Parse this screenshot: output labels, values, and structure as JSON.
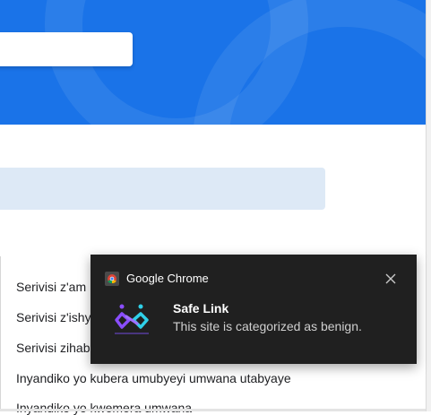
{
  "page": {
    "accent_color": "#1a73e8",
    "info_bar_color": "#dde9f6"
  },
  "list": {
    "items": [
      "Serivisi z'am",
      "Serivisi z'ishy",
      "Serivisi zihab",
      "Inyandiko yo kubera umubyeyi umwana utabyaye",
      "Inyandiko yo kwemera umwana"
    ]
  },
  "notification": {
    "app_name": "Google Chrome",
    "app_icon": "chrome-icon",
    "title": "Safe Link",
    "body": "This site is categorized as benign.",
    "close_icon": "close-icon",
    "logo_icon": "safe-link-logo",
    "background": "#202020"
  }
}
